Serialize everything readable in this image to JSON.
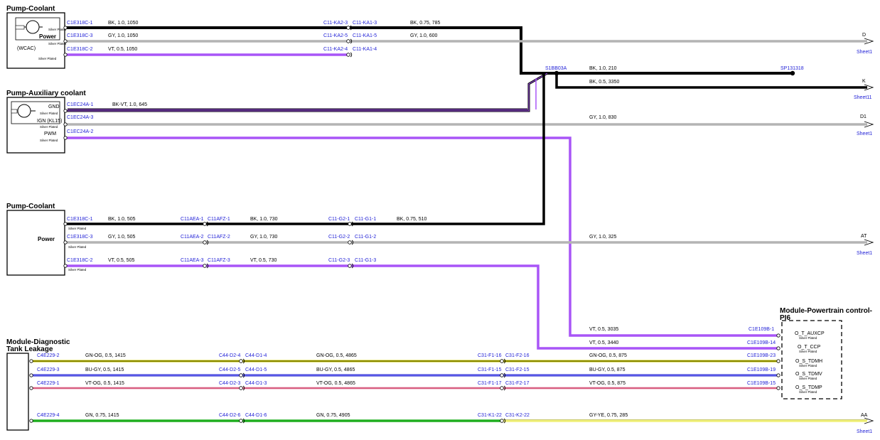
{
  "colors": {
    "BK": "#000000",
    "GY": "#b4b4b4",
    "VT": "#a855f7",
    "GN": "#1fae1f",
    "YE": "#f0f07a",
    "OG": "#c8c800",
    "BU": "#2222cc",
    "PK": "#e8a0b4",
    "label_blue": "#1f1fd6"
  },
  "components": [
    {
      "name": "Pump-Coolant",
      "pins": [
        "Power",
        "(WCAC)"
      ],
      "plating": [
        "Silver Plated",
        "Silver Plated",
        "Silver Plated"
      ]
    },
    {
      "name": "Pump-Auxiliary coolant",
      "pins": [
        "GND",
        "IGN (KL15)",
        "PWM"
      ],
      "plating": [
        "Silver Plated",
        "Silver Plated",
        "Silver Plated"
      ]
    },
    {
      "name": "Pump-Coolant",
      "pins": [
        "Power"
      ],
      "plating": [
        "Silver Plated",
        "Silver Plated",
        "Silver Plated"
      ]
    },
    {
      "name": "Module-Diagnostic Tank Leakage",
      "line1": "Module-Diagnostic",
      "line2": "Tank Leakage"
    },
    {
      "name": "Module-Powertrain control-PI6",
      "line1": "Module-Powertrain control-",
      "line2": "PI6",
      "pins": [
        "O_T_AUXCP",
        "O_T_CCP",
        "O_S_TDMH",
        "O_S_TDMV",
        "O_S_TDMP"
      ],
      "plating": "Silver Plated"
    }
  ],
  "wires": [
    {
      "id": "w1",
      "color": "BK",
      "labels": [
        "C1E318C-1",
        "BK, 1.0, 1050",
        "C11-KA2-3",
        "C11-KA1-3",
        "BK, 0.75, 785"
      ]
    },
    {
      "id": "w2",
      "color": "GY",
      "labels": [
        "C1E318C-3",
        "GY, 1.0, 1050",
        "C11-KA2-5",
        "C11-KA1-5",
        "GY, 1.0, 600"
      ],
      "offpage": {
        "ref": "D",
        "sheet": "Sheet1"
      }
    },
    {
      "id": "w3",
      "color": "VT",
      "labels": [
        "C1E318C-2",
        "VT, 0.5, 1050",
        "C11-KA2-4",
        "C11-KA1-4"
      ]
    },
    {
      "id": "w4",
      "color": "BK",
      "labels": [
        "S1BB03A",
        "BK, 1.0, 210",
        "SP131318"
      ]
    },
    {
      "id": "w5",
      "color": "BK",
      "labels": [
        "BK, 0.5, 3350"
      ],
      "offpage": {
        "ref": "K",
        "sheet": "Sheet11"
      }
    },
    {
      "id": "w6",
      "color": "BK-VT",
      "labels": [
        "C1EC24A-1",
        "BK-VT, 1.0, 645"
      ]
    },
    {
      "id": "w7",
      "color": "GY",
      "labels": [
        "C1EC24A-3",
        "GY, 1.0, 830"
      ],
      "offpage": {
        "ref": "D1",
        "sheet": "Sheet1"
      }
    },
    {
      "id": "w8",
      "color": "VT",
      "labels": [
        "C1EC24A-2"
      ]
    },
    {
      "id": "w9",
      "color": "BK",
      "labels": [
        "C1E318C-1",
        "BK, 1.0, 505",
        "C11AEA-1",
        "C11AFZ-1",
        "BK, 1.0, 730",
        "C11-G2-1",
        "C11-G1-1",
        "BK, 0.75, 510"
      ]
    },
    {
      "id": "w10",
      "color": "GY",
      "labels": [
        "C1E318C-3",
        "GY, 1.0, 505",
        "C11AEA-2",
        "C11AFZ-2",
        "GY, 1.0, 730",
        "C11-G2-2",
        "C11-G1-2",
        "GY, 1.0, 325"
      ],
      "offpage": {
        "ref": "AT",
        "sheet": "Sheet1"
      }
    },
    {
      "id": "w11",
      "color": "VT",
      "labels": [
        "C1E318C-2",
        "VT, 0.5, 505",
        "C11AEA-3",
        "C11AFZ-3",
        "VT, 0.5, 730",
        "C11-G2-3",
        "C11-G1-3"
      ]
    },
    {
      "id": "w12",
      "color": "VT",
      "labels": [
        "VT, 0.5, 3035",
        "C1E109B-1"
      ]
    },
    {
      "id": "w13",
      "color": "VT",
      "labels": [
        "VT, 0.5, 3440",
        "C1E109B-14"
      ]
    },
    {
      "id": "w14",
      "color": "GN-OG",
      "labels": [
        "C4E229-2",
        "GN-OG, 0.5, 1415",
        "C44-D2-4",
        "C44-D1-4",
        "GN-OG, 0.5, 4865",
        "C31-F1-16",
        "C31-F2-16",
        "GN-OG, 0.5, 875",
        "C1E109B-23"
      ]
    },
    {
      "id": "w15",
      "color": "BU-GY",
      "labels": [
        "C4E229-3",
        "BU-GY, 0.5, 1415",
        "C44-D2-5",
        "C44-D1-5",
        "BU-GY, 0.5, 4865",
        "C31-F1-15",
        "C31-F2-15",
        "BU-GY, 0.5, 875",
        "C1E109B-19"
      ]
    },
    {
      "id": "w16",
      "color": "VT-OG",
      "labels": [
        "C4E229-1",
        "VT-OG, 0.5, 1415",
        "C44-D2-3",
        "C44-D1-3",
        "VT-OG, 0.5, 4865",
        "C31-F1-17",
        "C31-F2-17",
        "VT-OG, 0.5, 875",
        "C1E109B-15"
      ]
    },
    {
      "id": "w17",
      "color": "GN / GY-YE",
      "labels": [
        "C4E229-4",
        "GN, 0.75, 1415",
        "C44-D2-6",
        "C44-D1-6",
        "GN, 0.75, 4905",
        "C31-K1-22",
        "C31-K2-22",
        "GY-YE, 0.75, 285"
      ],
      "offpage": {
        "ref": "AA",
        "sheet": "Sheet1"
      }
    }
  ]
}
